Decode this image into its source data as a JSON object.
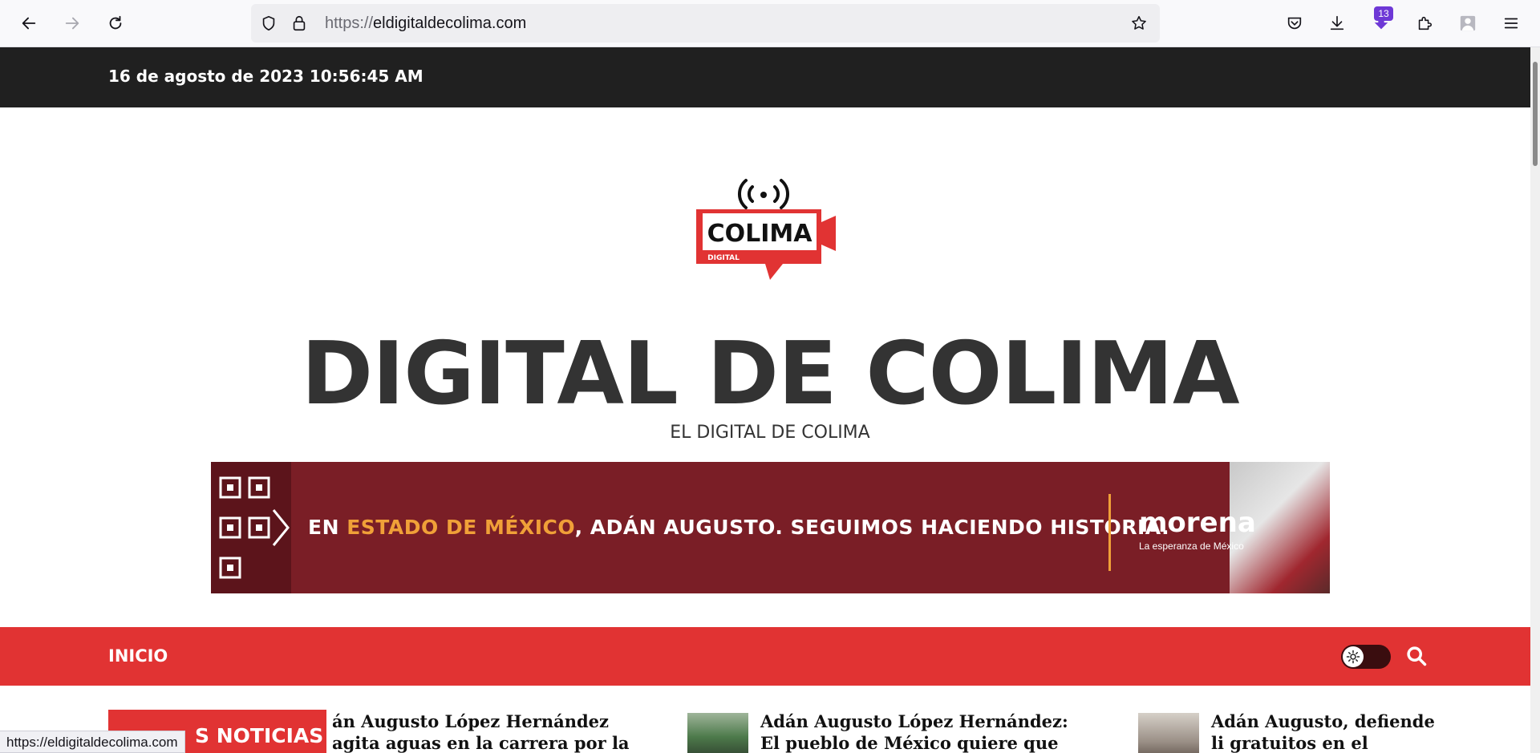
{
  "browser": {
    "url_scheme": "https://",
    "url_host": "eldigitaldecolima.com",
    "extension_badge": "13",
    "status_url": "https://eldigitaldecolima.com",
    "icons": [
      "back-arrow-icon",
      "forward-arrow-icon",
      "reload-icon",
      "shield-icon",
      "lock-icon",
      "star-icon",
      "pocket-icon",
      "download-icon",
      "extension-icon",
      "puzzle-icon",
      "profile-icon",
      "hamburger-menu-icon"
    ]
  },
  "site": {
    "datetime": "16 de agosto de 2023 10:56:45 AM",
    "logo_text": "COLIMA",
    "logo_subtext": "DIGITAL",
    "title": "DIGITAL DE COLIMA",
    "tagline": "EL DIGITAL DE COLIMA"
  },
  "banner": {
    "text_prefix": "EN ",
    "text_highlight": "ESTADO DE MÉXICO",
    "text_suffix": ", ADÁN AUGUSTO. SEGUIMOS HACIENDO HISTORIA.",
    "brand": "morena",
    "slogan": "La esperanza de México"
  },
  "nav": {
    "home": "INICIO"
  },
  "news": {
    "label": "S NOTICIAS",
    "items": [
      {
        "title": "án Augusto López Hernández agita aguas en la carrera por la"
      },
      {
        "title": "Adán Augusto López Hernández: El pueblo de México quiere que siga la"
      },
      {
        "title": "Adán Augusto, defiende li gratuitos en el municipio"
      }
    ]
  },
  "colors": {
    "topbar": "#202020",
    "navbar": "#e13333",
    "banner": "#7a1e26",
    "accent": "#f0a038"
  }
}
